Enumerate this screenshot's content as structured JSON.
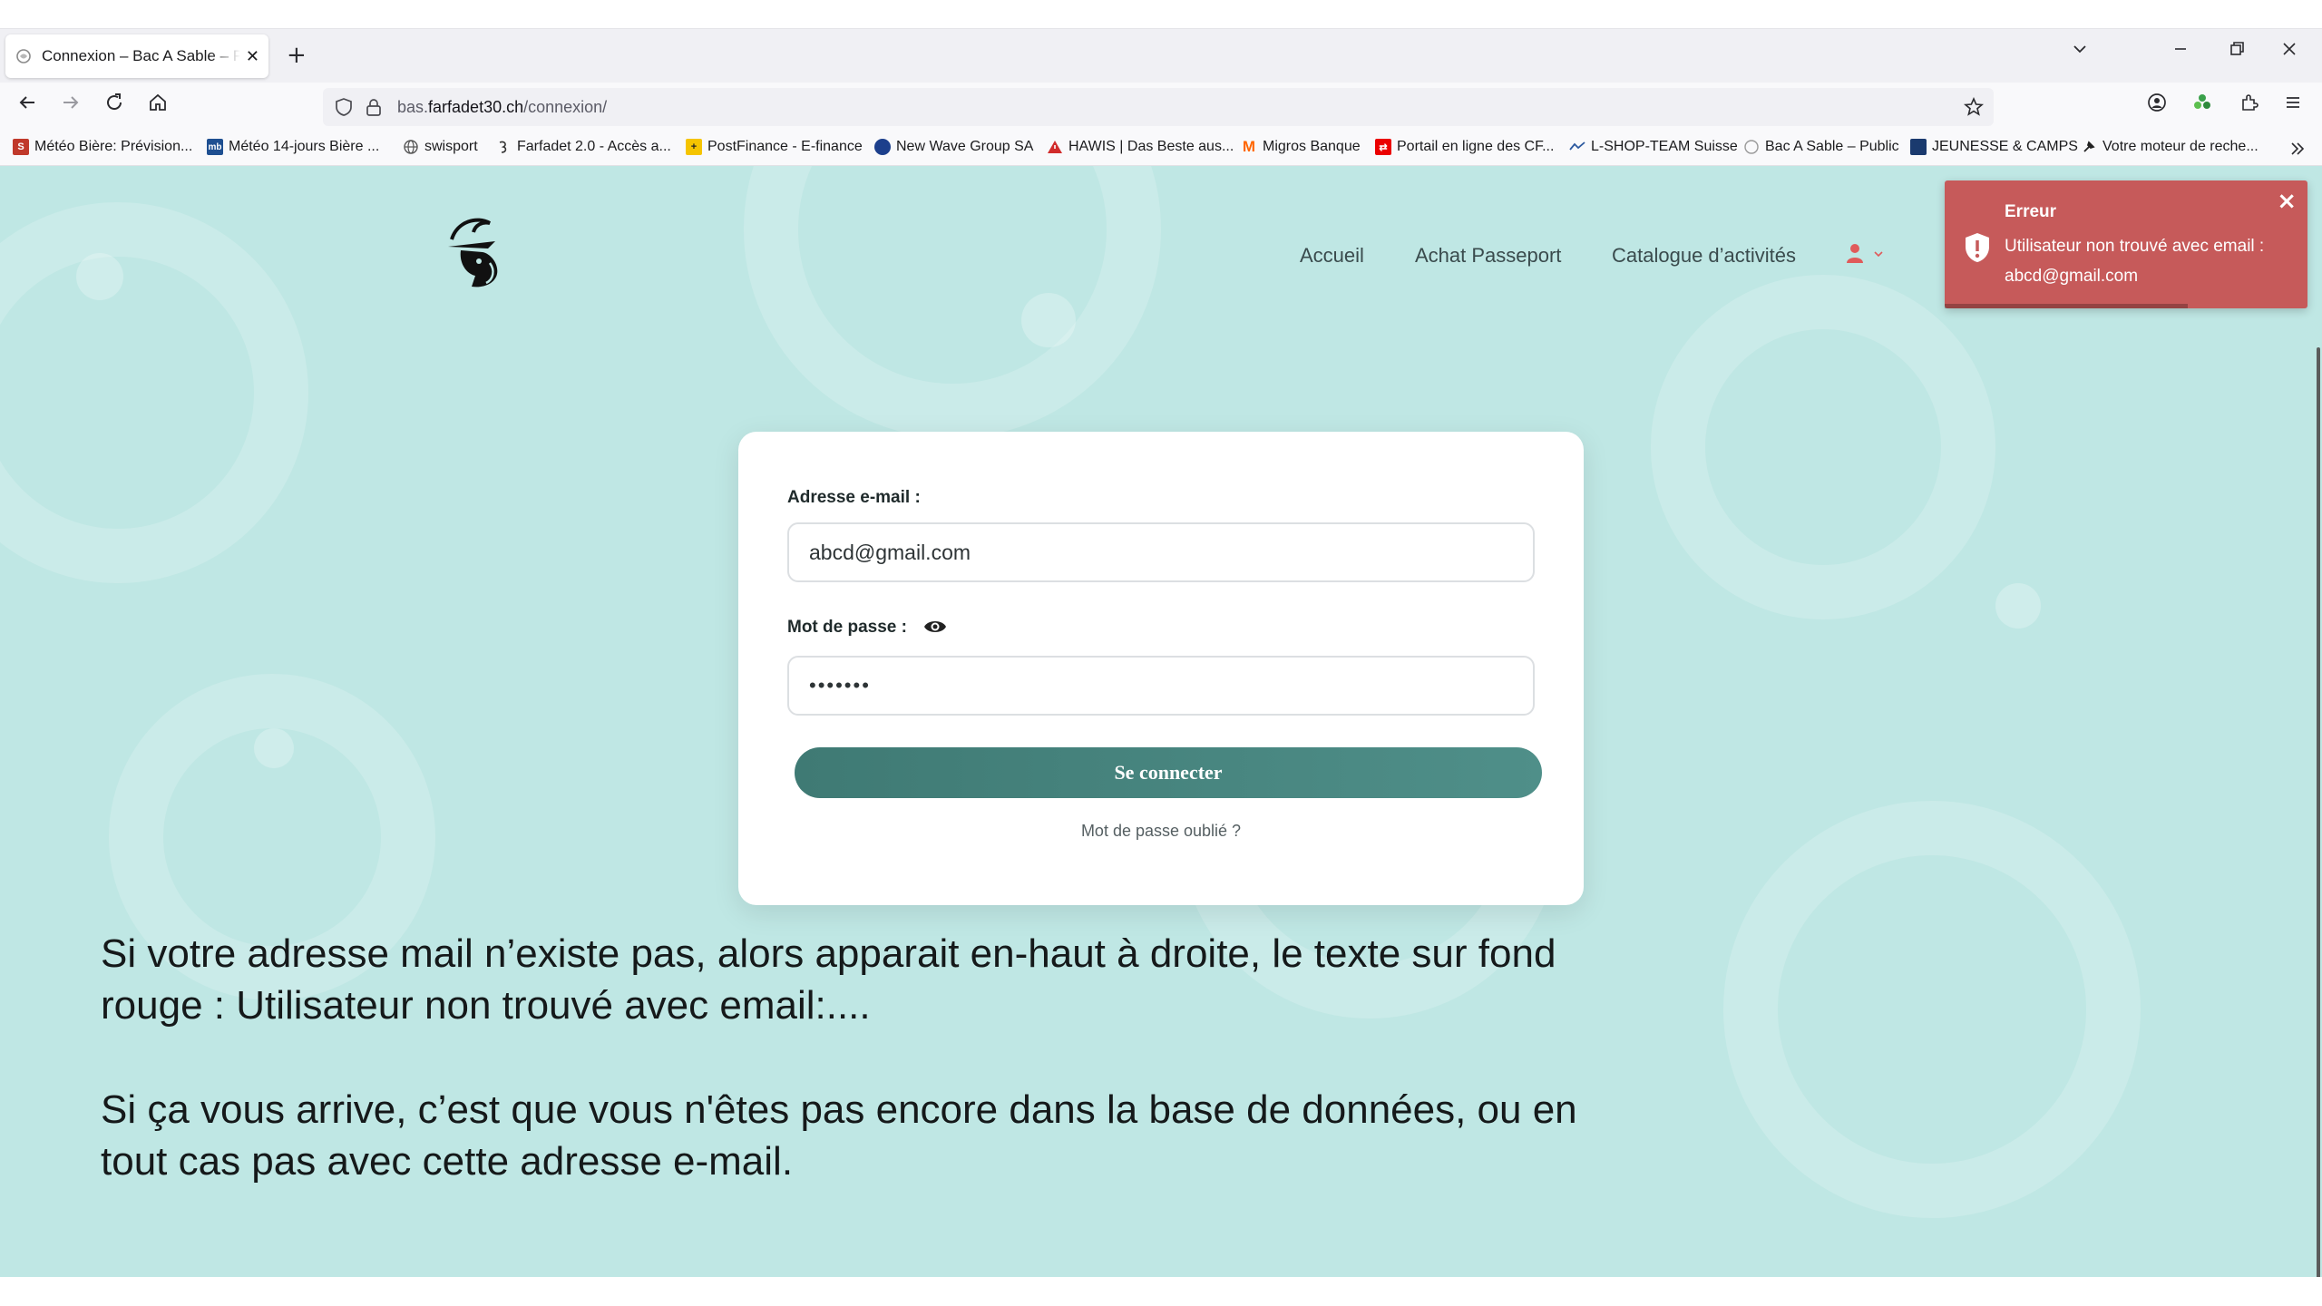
{
  "browser": {
    "tab_title": "Connexion – Bac A Sable – Passeport",
    "tab_close": "✕",
    "new_tab": "+",
    "url_prefix": "bas.",
    "url_domain": "farfadet30.ch",
    "url_path": "/connexion/",
    "bookmarks": [
      {
        "label": "Météo Bière: Prévision...",
        "icon": "S",
        "color": "#c0392b"
      },
      {
        "label": "Météo 14-jours Bière ...",
        "icon": "mb",
        "color": "#1e4f91"
      },
      {
        "label": "swisport",
        "icon": "globe-icon",
        "color": "#555555"
      },
      {
        "label": "Farfadet 2.0 - Accès a...",
        "icon": "farfadet-icon",
        "color": "#333333"
      },
      {
        "label": "PostFinance - E-finance",
        "icon": "postfinance-icon",
        "color": "#f5c400"
      },
      {
        "label": "New Wave Group SA",
        "icon": "newwave-icon",
        "color": "#1c3f8c"
      },
      {
        "label": "HAWIS | Das Beste aus...",
        "icon": "warning-icon",
        "color": "#d12b2b"
      },
      {
        "label": "Migros Banque",
        "icon": "M",
        "color": "#ff6600"
      },
      {
        "label": "Portail en ligne des CF...",
        "icon": "sbb-icon",
        "color": "#eb0000"
      },
      {
        "label": "L-SHOP-TEAM Suisse",
        "icon": "lshop-icon",
        "color": "#2d5aa0"
      },
      {
        "label": "Bac A Sable – Public",
        "icon": "bas-icon",
        "color": "#888888"
      },
      {
        "label": "JEUNESSE & CAMPS",
        "icon": "jc-icon",
        "color": "#1a3a6e"
      },
      {
        "label": "Votre moteur de reche...",
        "icon": "pin-icon",
        "color": "#222222"
      }
    ]
  },
  "site": {
    "nav": [
      "Accueil",
      "Achat Passeport",
      "Catalogue d’activités"
    ],
    "accent": "#e05a5a"
  },
  "form": {
    "email_label": "Adresse e-mail :",
    "email_value": "abcd@gmail.com",
    "password_label": "Mot de passe :",
    "password_value": "•••••••",
    "submit_label": "Se connecter",
    "forgot_label": "Mot de passe oublié ?"
  },
  "toast": {
    "title": "Erreur",
    "message": "Utilisateur non trouvé avec email : abcd@gmail.com",
    "close": "×",
    "color": "#c65a5a",
    "progress_fraction": 0.67
  },
  "notes": {
    "p1": "Si votre adresse mail n’existe pas, alors apparait en-haut à droite, le texte sur fond rouge : Utilisateur non trouvé avec email:....",
    "p2": "Si ça vous arrive, c’est que vous n'êtes pas encore dans la base de données, ou en tout cas pas avec cette adresse e-mail."
  }
}
